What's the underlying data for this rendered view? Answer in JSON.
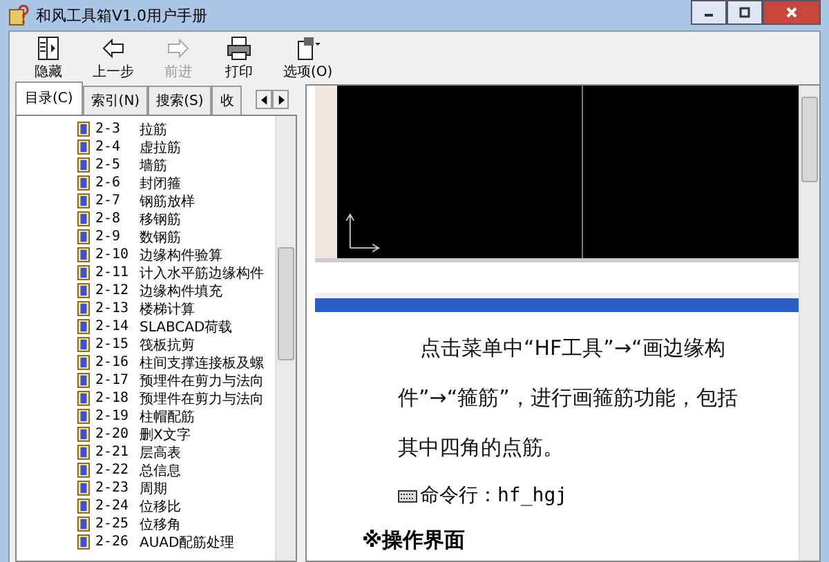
{
  "window": {
    "title": "和风工具箱V1.0用户手册"
  },
  "toolbar": [
    {
      "label": "隐藏",
      "kind": "hide",
      "disabled": false
    },
    {
      "label": "上一步",
      "kind": "back",
      "disabled": false
    },
    {
      "label": "前进",
      "kind": "forward",
      "disabled": true
    },
    {
      "label": "打印",
      "kind": "print",
      "disabled": false
    },
    {
      "label": "选项(O)",
      "kind": "options",
      "disabled": false
    }
  ],
  "tabs": [
    {
      "label": "目录(C)",
      "selected": true
    },
    {
      "label": "索引(N)",
      "selected": false
    },
    {
      "label": "搜索(S)",
      "selected": false
    },
    {
      "label": "收",
      "selected": false
    }
  ],
  "tree": [
    {
      "number": "2-3",
      "title": "拉筋"
    },
    {
      "number": "2-4",
      "title": "虚拉筋"
    },
    {
      "number": "2-5",
      "title": "墙筋"
    },
    {
      "number": "2-6",
      "title": "封闭箍"
    },
    {
      "number": "2-7",
      "title": "钢筋放样"
    },
    {
      "number": "2-8",
      "title": "移钢筋"
    },
    {
      "number": "2-9",
      "title": "数钢筋"
    },
    {
      "number": "2-10",
      "title": "边缘构件验算"
    },
    {
      "number": "2-11",
      "title": "计入水平筋边缘构件"
    },
    {
      "number": "2-12",
      "title": "边缘构件填充"
    },
    {
      "number": "2-13",
      "title": "楼梯计算"
    },
    {
      "number": "2-14",
      "title": "SLABCAD荷载"
    },
    {
      "number": "2-15",
      "title": "筏板抗剪"
    },
    {
      "number": "2-16",
      "title": "柱间支撑连接板及螺"
    },
    {
      "number": "2-17",
      "title": "预埋件在剪力与法向"
    },
    {
      "number": "2-18",
      "title": "预埋件在剪力与法向"
    },
    {
      "number": "2-19",
      "title": "柱帽配筋"
    },
    {
      "number": "2-20",
      "title": "删X文字"
    },
    {
      "number": "2-21",
      "title": "层高表"
    },
    {
      "number": "2-22",
      "title": "总信息"
    },
    {
      "number": "2-23",
      "title": "周期"
    },
    {
      "number": "2-24",
      "title": "位移比"
    },
    {
      "number": "2-25",
      "title": "位移角"
    },
    {
      "number": "2-26",
      "title": "AUAD配筋处理"
    }
  ],
  "content": {
    "paragraph": "点击菜单中“HF工具”→“画边缘构件”→“箍筋”，进行画箍筋功能，包括其中四角的点筋。",
    "command": "命令行：hf_hgj",
    "heading": "※操作界面"
  }
}
